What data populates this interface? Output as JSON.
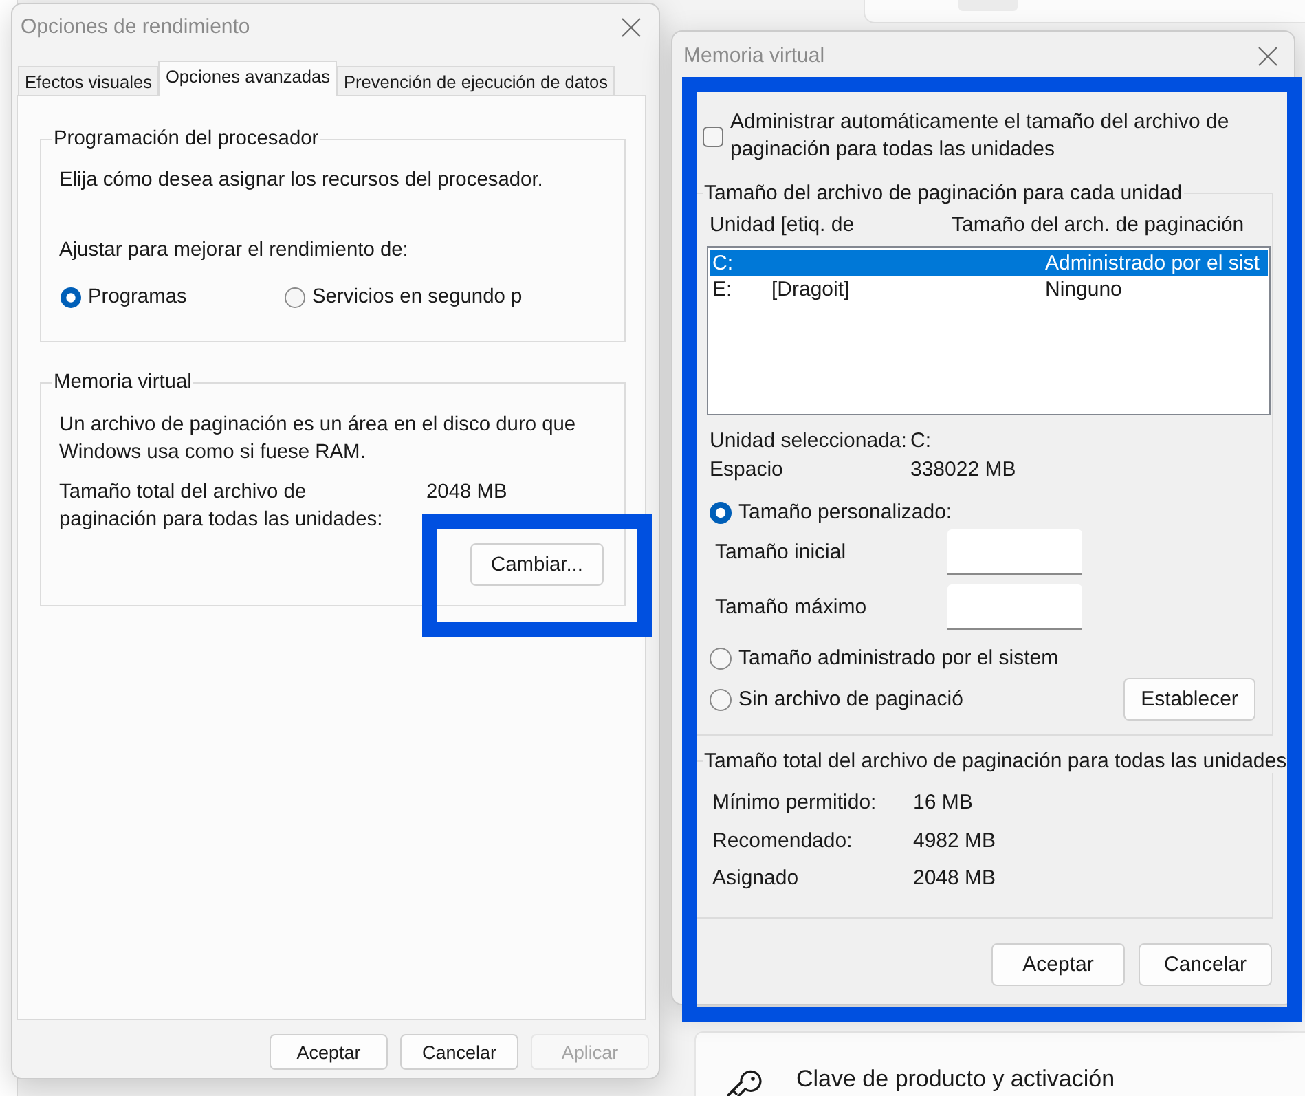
{
  "performance_dialog": {
    "title": "Opciones de rendimiento",
    "tabs": [
      {
        "label": "Efectos visuales",
        "selected": false
      },
      {
        "label": "Opciones avanzadas",
        "selected": true
      },
      {
        "label": "Prevención de ejecución de datos",
        "selected": false
      }
    ],
    "processor_scheduling": {
      "title": "Programación del procesador",
      "description": "Elija cómo desea asignar los recursos del procesador.",
      "adjust_label": "Ajustar para mejorar el rendimiento de:",
      "options": [
        {
          "label": "Programas",
          "selected": true
        },
        {
          "label": "Servicios en segundo p",
          "selected": false
        }
      ]
    },
    "virtual_memory": {
      "title": "Memoria virtual",
      "description": "Un archivo de paginación es un área en el disco duro que Windows usa como si fuese RAM.",
      "total_label": "Tamaño total del archivo de paginación para todas las unidades:",
      "total_value": "2048 MB",
      "change_button": "Cambiar..."
    },
    "buttons": [
      {
        "label": "Aceptar",
        "disabled": false
      },
      {
        "label": "Cancelar",
        "disabled": false
      },
      {
        "label": "Aplicar",
        "disabled": true
      }
    ]
  },
  "virtual_memory_dialog": {
    "title": "Memoria virtual",
    "auto_manage": {
      "label": "Administrar automáticamente el tamaño del archivo de paginación para todas las unidades",
      "checked": false
    },
    "per_drive": {
      "title": "Tamaño del archivo de paginación para cada unidad",
      "columns": [
        "Unidad [etiq. de",
        "Tamaño del arch. de paginación"
      ],
      "drives": [
        {
          "unit": "C:",
          "size": "Administrado por el sist",
          "selected": true
        },
        {
          "unit": "E:",
          "volume_label": "[Dragoit]",
          "size": "Ninguno",
          "selected": false
        }
      ],
      "selected_drive": {
        "label": "Unidad seleccionada:",
        "value": "C:"
      },
      "space": {
        "label": "Espacio",
        "value": "338022 MB"
      },
      "size_options": [
        {
          "label": "Tamaño personalizado:",
          "selected": true
        },
        {
          "label": "Tamaño administrado por el sistem",
          "selected": false
        },
        {
          "label": "Sin archivo de paginació",
          "selected": false
        }
      ],
      "size_fields": [
        {
          "label": "Tamaño inicial"
        },
        {
          "label": "Tamaño máximo"
        }
      ],
      "set_button": "Establecer"
    },
    "totals": {
      "title": "Tamaño total del archivo de paginación para todas las unidades",
      "rows": [
        {
          "label": "Mínimo permitido:",
          "value": "16 MB"
        },
        {
          "label": "Recomendado:",
          "value": "4982 MB"
        },
        {
          "label": "Asignado",
          "value": "2048 MB"
        }
      ]
    },
    "buttons": [
      {
        "label": "Aceptar"
      },
      {
        "label": "Cancelar"
      }
    ]
  },
  "settings_background": {
    "item": "Clave de producto y activación"
  }
}
